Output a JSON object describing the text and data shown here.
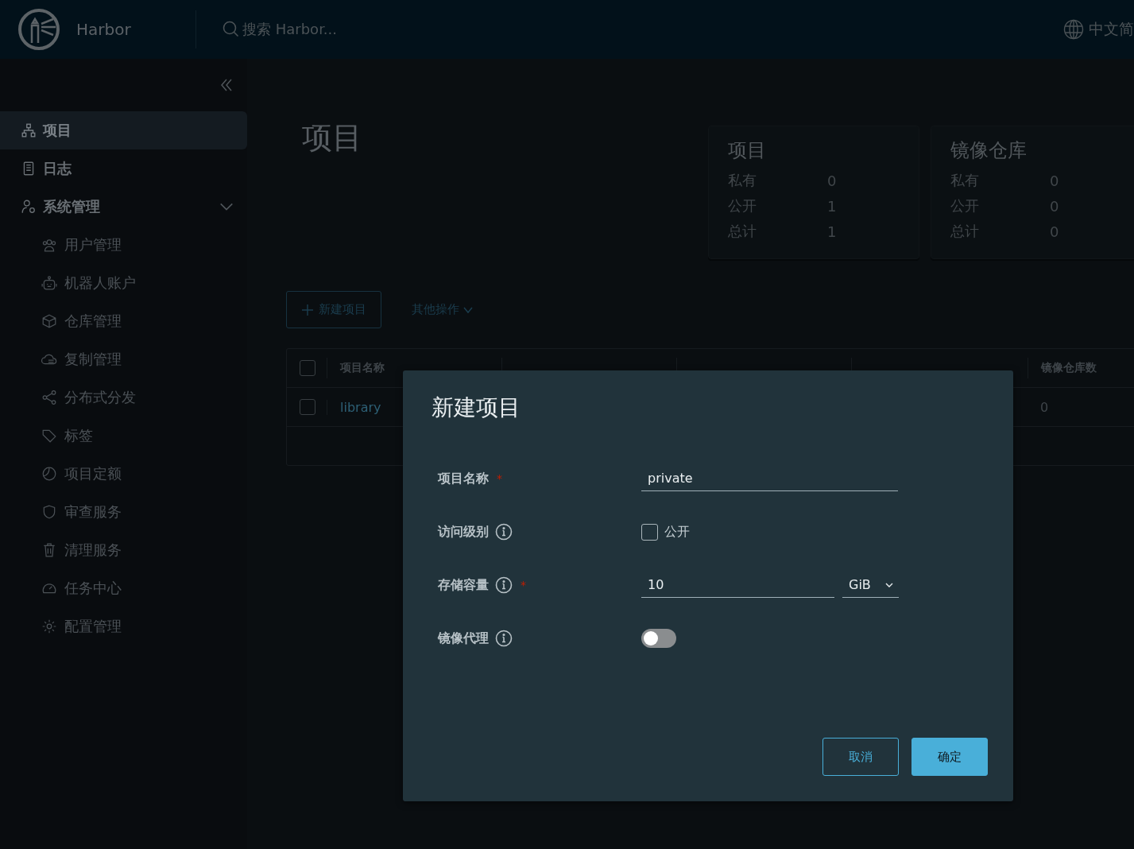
{
  "header": {
    "brand": "Harbor",
    "search_placeholder": "搜索 Harbor...",
    "language": "中文简"
  },
  "sidebar": {
    "items": [
      {
        "label": "项目",
        "selected": true
      },
      {
        "label": "日志",
        "selected": false
      },
      {
        "label": "系统管理",
        "selected": false,
        "expanded": true,
        "children": [
          {
            "label": "用户管理",
            "selected": false
          },
          {
            "label": "机器人账户",
            "selected": false
          },
          {
            "label": "仓库管理",
            "selected": false
          },
          {
            "label": "复制管理",
            "selected": false
          },
          {
            "label": "分布式分发",
            "selected": false
          },
          {
            "label": "标签",
            "selected": false
          },
          {
            "label": "项目定额",
            "selected": false
          },
          {
            "label": "审查服务",
            "selected": false
          },
          {
            "label": "清理服务",
            "selected": false
          },
          {
            "label": "任务中心",
            "selected": false
          },
          {
            "label": "配置管理",
            "selected": false
          }
        ]
      }
    ]
  },
  "page_title": "项目",
  "stats": [
    {
      "title": "项目",
      "rows": [
        {
          "label": "私有",
          "value": "0"
        },
        {
          "label": "公开",
          "value": "1"
        },
        {
          "label": "总计",
          "value": "1"
        }
      ]
    },
    {
      "title": "镜像仓库",
      "rows": [
        {
          "label": "私有",
          "value": "0"
        },
        {
          "label": "公开",
          "value": "0"
        },
        {
          "label": "总计",
          "value": "0"
        }
      ]
    }
  ],
  "toolbar": {
    "new_button": "新建项目",
    "other_actions": "其他操作"
  },
  "table": {
    "header_checked": false,
    "columns": [
      "项目名称",
      "镜像仓库数"
    ],
    "rows": [
      {
        "checked": false,
        "name": "library",
        "repo_count": "0"
      }
    ]
  },
  "dialog": {
    "title": "新建项目",
    "required_mark": "*",
    "fields": [
      {
        "kind": "text",
        "label": "项目名称",
        "required": true,
        "info": false,
        "value": "private"
      },
      {
        "kind": "checkbox",
        "label": "访问级别",
        "required": false,
        "info": true,
        "option": "公开",
        "checked": false
      },
      {
        "kind": "quota",
        "label": "存储容量",
        "required": true,
        "info": true,
        "value": "10",
        "unit": "GiB"
      },
      {
        "kind": "toggle",
        "label": "镜像代理",
        "required": false,
        "info": true,
        "on": false
      }
    ],
    "cancel": "取消",
    "ok": "确定"
  }
}
